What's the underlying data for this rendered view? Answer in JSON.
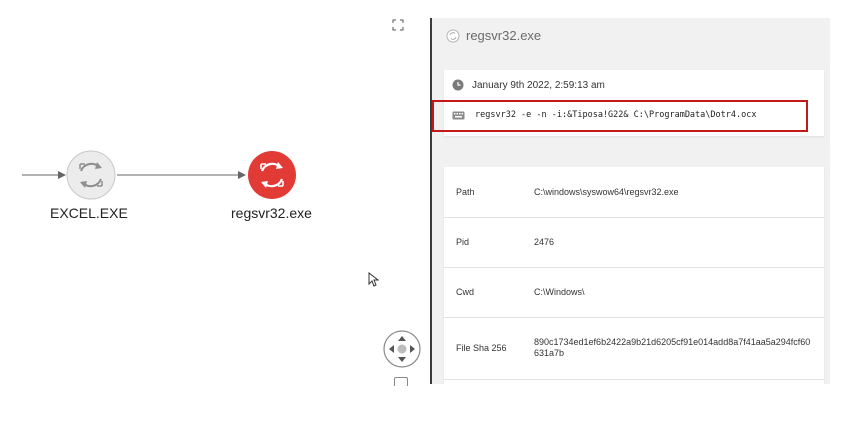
{
  "graph": {
    "nodes": [
      {
        "label": "EXCEL.EXE",
        "icon": "process-cycle-icon",
        "color": "#e9e9e9"
      },
      {
        "label": "regsvr32.exe",
        "icon": "process-cycle-icon",
        "color": "#e23b36"
      }
    ]
  },
  "panel": {
    "title": "regsvr32.exe",
    "timestamp": "January 9th 2022, 2:59:13 am",
    "command": "regsvr32 -e -n -i:&Tiposa!G22&  C:\\ProgramData\\Dotr4.ocx",
    "highlight_color": "#c41818",
    "details": [
      {
        "key": "Path",
        "value": "C:\\windows\\syswow64\\regsvr32.exe"
      },
      {
        "key": "Pid",
        "value": "2476"
      },
      {
        "key": "Cwd",
        "value": "C:\\Windows\\"
      },
      {
        "key": "File Sha 256",
        "value": "890c1734ed1ef6b2422a9b21d6205cf91e014add8a7f41aa5a294fcf60631a7b"
      }
    ]
  }
}
